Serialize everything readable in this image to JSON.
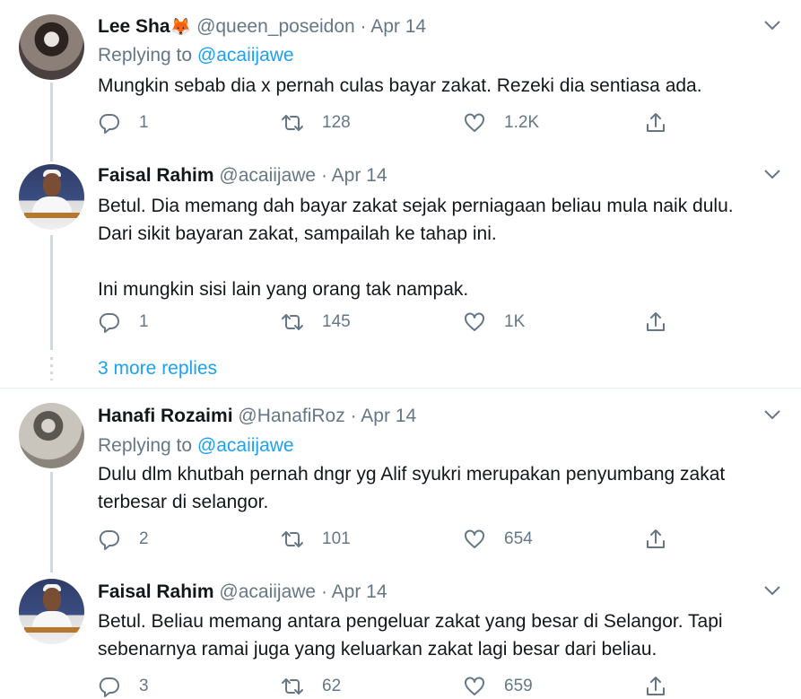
{
  "tweets": [
    {
      "name": "Lee Sha",
      "emoji": "🦊",
      "handle": "@queen_poseidon",
      "date": "Apr 14",
      "replying_label": "Replying to",
      "replying_to": "@acaiijawe",
      "text_lines": [
        "Mungkin sebab dia x pernah culas bayar zakat. Rezeki dia sentiasa ada."
      ],
      "replies": "1",
      "retweets": "128",
      "likes": "1.2K"
    },
    {
      "name": "Faisal Rahim",
      "handle": "@acaiijawe",
      "date": "Apr 14",
      "text_lines": [
        "Betul. Dia memang dah bayar zakat sejak perniagaan beliau mula naik dulu.",
        "Dari sikit bayaran zakat, sampailah ke tahap ini.",
        "",
        "Ini mungkin sisi lain yang orang tak nampak."
      ],
      "replies": "1",
      "retweets": "145",
      "likes": "1K"
    },
    {
      "name": "Hanafi Rozaimi",
      "handle": "@HanafiRoz",
      "date": "Apr 14",
      "replying_label": "Replying to",
      "replying_to": "@acaiijawe",
      "text_lines": [
        "Dulu dlm khutbah pernah dngr yg Alif syukri merupakan penyumbang zakat",
        "terbesar di selangor."
      ],
      "replies": "2",
      "retweets": "101",
      "likes": "654"
    },
    {
      "name": "Faisal Rahim",
      "handle": "@acaiijawe",
      "date": "Apr 14",
      "text_lines": [
        "Betul. Beliau memang antara pengeluar zakat yang besar di Selangor. Tapi",
        "sebenarnya ramai juga yang keluarkan zakat lagi besar dari beliau."
      ],
      "replies": "3",
      "retweets": "62",
      "likes": "659"
    }
  ],
  "more_replies": "3 more replies",
  "separator": "·",
  "colors": {
    "link": "#1da1f2",
    "muted": "#657786",
    "text": "#14171a",
    "thread_line": "#cfd9de"
  }
}
